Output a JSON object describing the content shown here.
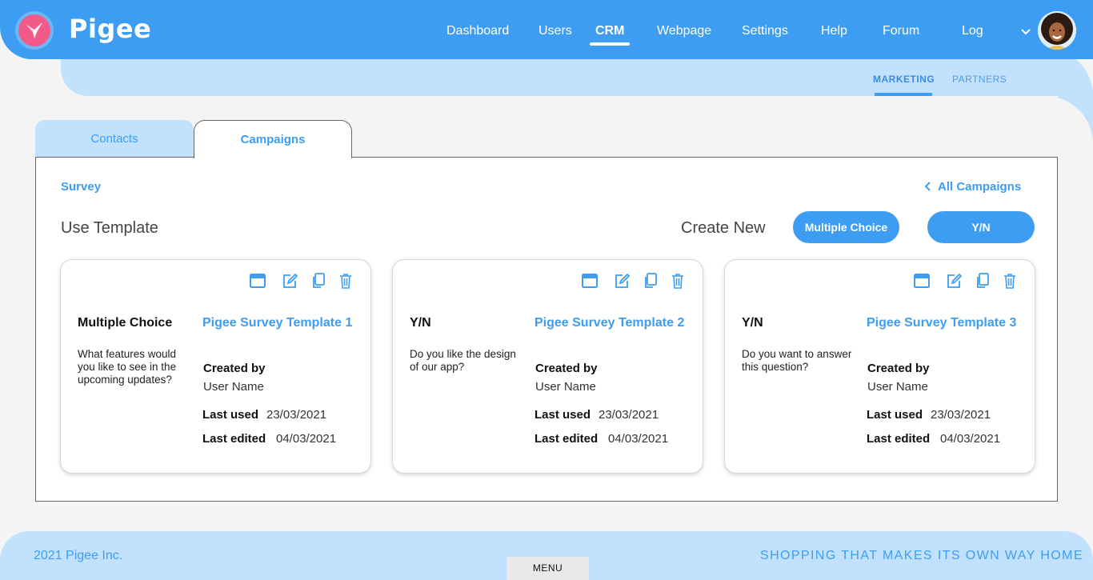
{
  "brand": {
    "name": "Pigee"
  },
  "nav": {
    "items": [
      {
        "label": "Dashboard"
      },
      {
        "label": "Users"
      },
      {
        "label": "CRM"
      },
      {
        "label": "Webpage"
      },
      {
        "label": "Settings"
      },
      {
        "label": "Help"
      },
      {
        "label": "Forum"
      },
      {
        "label": "Log"
      }
    ],
    "active": "CRM"
  },
  "subnav": {
    "items": [
      {
        "label": "MARKETING"
      },
      {
        "label": "PARTNERS"
      }
    ],
    "active": "MARKETING"
  },
  "tabs": [
    {
      "label": "Contacts"
    },
    {
      "label": "Campaigns"
    }
  ],
  "activeTab": "Campaigns",
  "panel": {
    "breadcrumb": "Survey",
    "all_campaigns": "All Campaigns",
    "use_template": "Use Template",
    "create_new": "Create New",
    "btn_multiple_choice": "Multiple Choice",
    "btn_yn": "Y/N"
  },
  "cards": [
    {
      "type": "Multiple Choice",
      "title": "Pigee Survey Template 1",
      "question": "What features would you like to see in the upcoming updates?",
      "created_by_label": "Created by",
      "created_by": "User Name",
      "last_used_label": "Last used",
      "last_used": "23/03/2021",
      "last_edited_label": "Last edited",
      "last_edited": "04/03/2021"
    },
    {
      "type": "Y/N",
      "title": "Pigee Survey Template 2",
      "question": "Do you like the design of our app?",
      "created_by_label": "Created by",
      "created_by": "User Name",
      "last_used_label": "Last used",
      "last_used": "23/03/2021",
      "last_edited_label": "Last edited",
      "last_edited": "04/03/2021"
    },
    {
      "type": "Y/N",
      "title": "Pigee Survey Template 3",
      "question": "Do you want to answer this question?",
      "created_by_label": "Created by",
      "created_by": "User Name",
      "last_used_label": "Last used",
      "last_used": "23/03/2021",
      "last_edited_label": "Last edited",
      "last_edited": "04/03/2021"
    }
  ],
  "card_icons": [
    "window-icon",
    "edit-icon",
    "copy-icon",
    "trash-icon"
  ],
  "footer": {
    "copyright": "2021 Pigee Inc.",
    "menu": "MENU",
    "tagline": "SHOPPING THAT MAKES ITS OWN WAY HOME"
  },
  "colors": {
    "primary": "#3d9df2",
    "light": "#c2e1fc",
    "logo_pink": "#f25a8a",
    "background": "#f4f4f4"
  }
}
